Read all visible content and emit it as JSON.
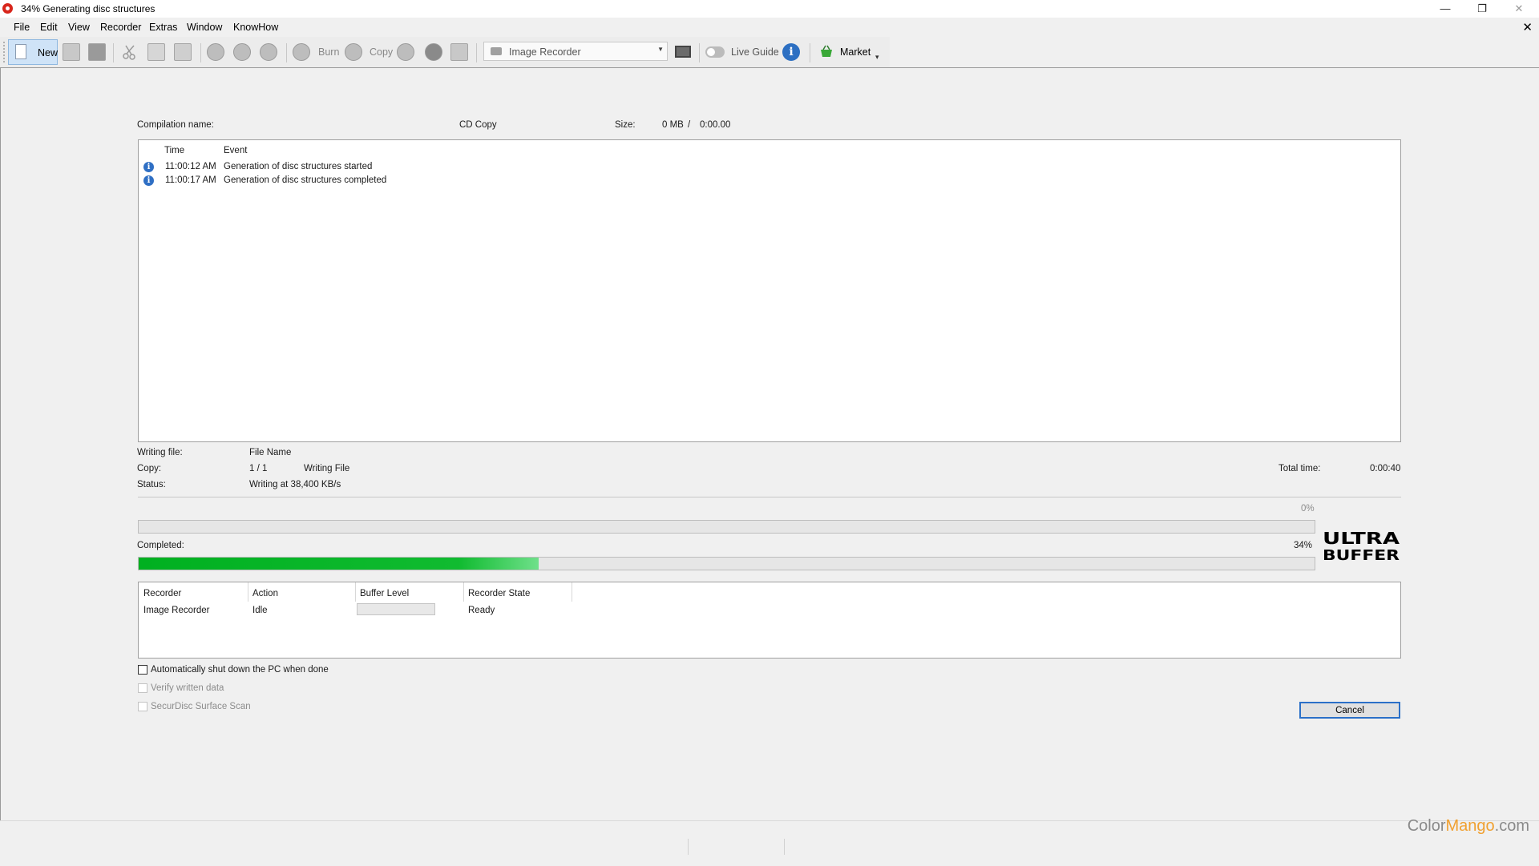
{
  "window": {
    "title": "34% Generating disc structures",
    "controls": [
      "—",
      "❐",
      "✕"
    ]
  },
  "menu": {
    "items": [
      "File",
      "Edit",
      "View",
      "Recorder",
      "Extras",
      "Window",
      "KnowHow"
    ],
    "close_glyph": "✕"
  },
  "toolbar": {
    "new_label": "New",
    "burn_label": "Burn",
    "copy_label": "Copy",
    "recorder_select": "Image Recorder",
    "live_guide_label": "Live Guide",
    "info_glyph": "i",
    "market_label": "Market",
    "overflow_glyph": "▾"
  },
  "compilation": {
    "name_label": "Compilation name:",
    "name_value": "CD Copy",
    "size_label": "Size:",
    "size_mb": "0 MB",
    "size_sep": "/",
    "size_time": "0:00.00"
  },
  "log": {
    "columns": [
      "Time",
      "Event"
    ],
    "rows": [
      {
        "time": "11:00:12 AM",
        "event": "Generation of disc structures started"
      },
      {
        "time": "11:00:17 AM",
        "event": "Generation of disc structures completed"
      }
    ]
  },
  "details": {
    "writing_file_label": "Writing file:",
    "writing_file_value": "File Name",
    "copy_label": "Copy:",
    "copy_value": "1 / 1",
    "copy_action": "Writing File",
    "status_label": "Status:",
    "status_value": "Writing at 38,400 KB/s",
    "total_time_label": "Total time:",
    "total_time_value": "0:00:40"
  },
  "progress": {
    "file_percent_label": "0%",
    "file_fraction": 0.0,
    "completed_label": "Completed:",
    "completed_percent_label": "34%",
    "completed_fraction": 0.34
  },
  "logo": {
    "line1": "ULTRA",
    "line2": "BUFFER"
  },
  "recorder_table": {
    "columns": [
      "Recorder",
      "Action",
      "Buffer Level",
      "Recorder State"
    ],
    "rows": [
      {
        "recorder": "Image Recorder",
        "action": "Idle",
        "buffer_level": 0.0,
        "state": "Ready"
      }
    ]
  },
  "options": {
    "shutdown_label": "Automatically shut down the PC when done",
    "shutdown_checked": false,
    "verify_label": "Verify written data",
    "verify_checked": false,
    "securdisc_label": "SecurDisc Surface Scan",
    "securdisc_checked": false
  },
  "cancel_label": "Cancel",
  "watermark": {
    "part1": "Color",
    "part2": "Mango",
    "part3": ".com"
  },
  "colors": {
    "progress_green": "#00b020",
    "focus_blue": "#2b70c8",
    "info_blue": "#2f6fc4"
  }
}
